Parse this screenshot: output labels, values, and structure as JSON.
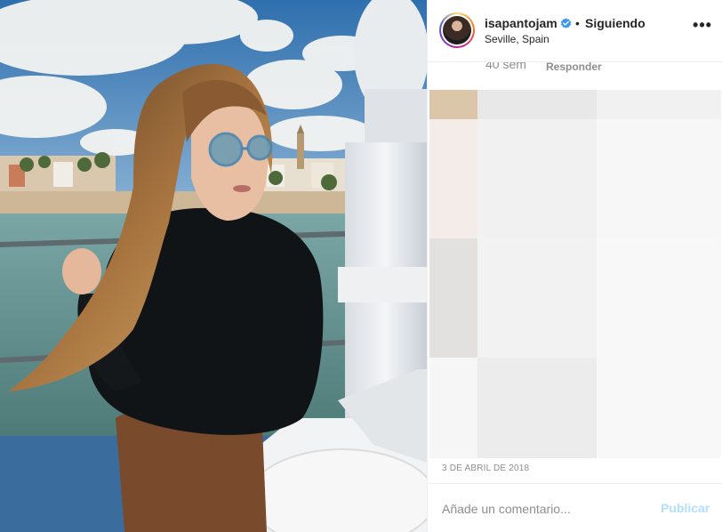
{
  "post": {
    "username": "isapantojam",
    "verified_icon": "verified-badge-icon",
    "separator": "•",
    "follow_state": "Siguiendo",
    "location": "Seville, Spain",
    "more_icon": "more-options-icon",
    "more_label": "•••"
  },
  "comment_meta": {
    "time": "40 sem",
    "reply_label": "Responder"
  },
  "date": "3 DE ABRIL DE 2018",
  "comment_box": {
    "placeholder": "Añade un comentario...",
    "publish_label": "Publicar"
  },
  "colors": {
    "verified_blue": "#3897f0",
    "publish_disabled": "#b2dffc",
    "muted_text": "#8e8e8e"
  }
}
